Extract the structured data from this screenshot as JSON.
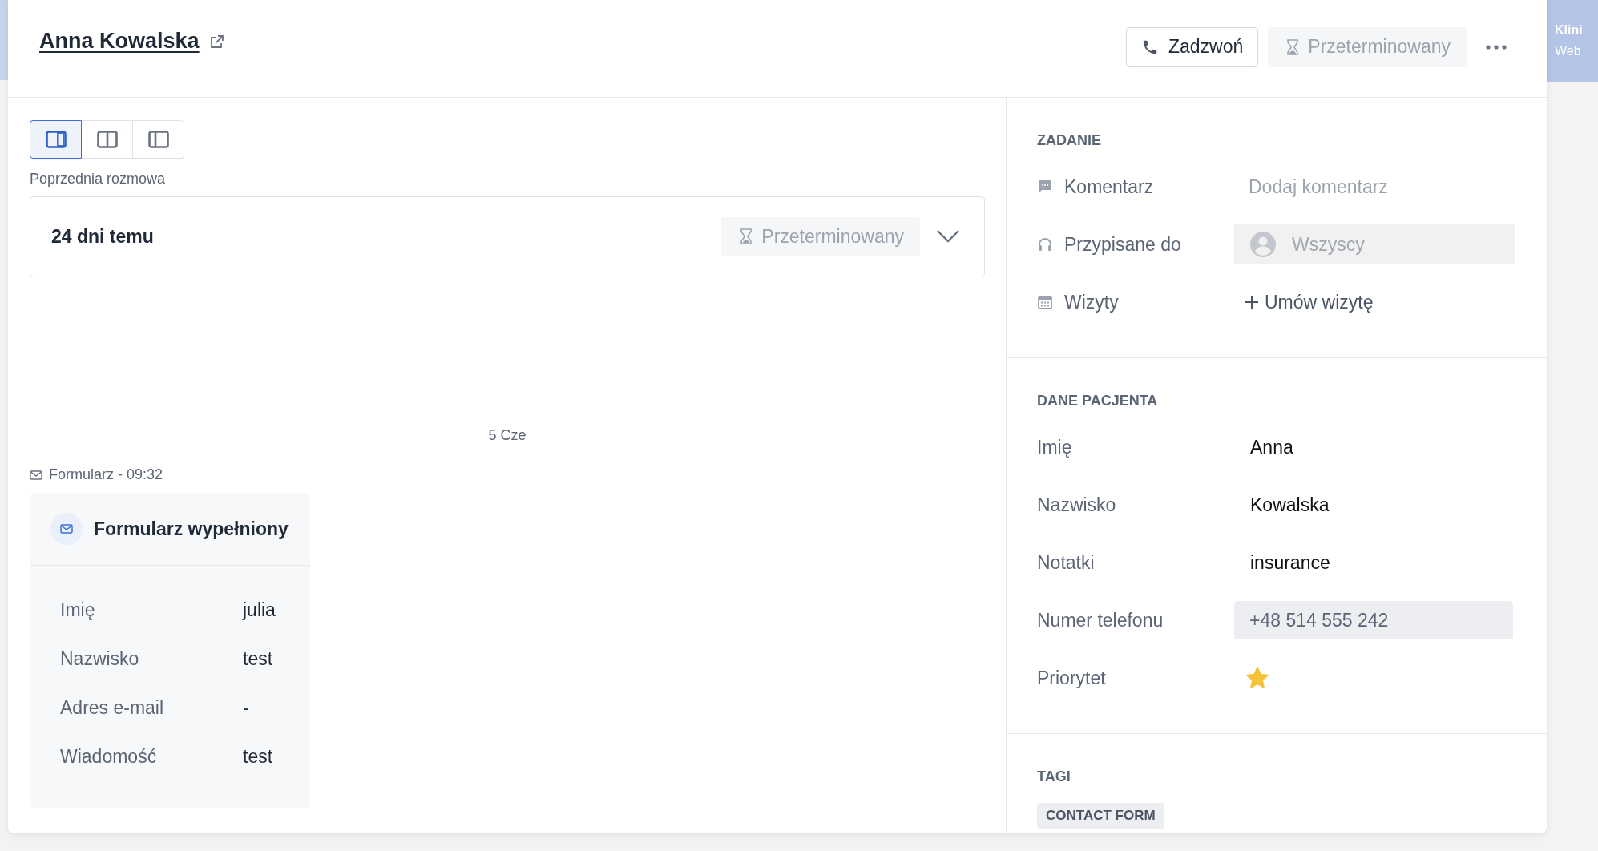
{
  "backdrop": {
    "right_title": "Klini",
    "right_subtitle": "Web"
  },
  "header": {
    "title": "Anna Kowalska",
    "call_button": "Zadzwoń",
    "status": "Przeterminowany"
  },
  "view_modes": [
    {
      "kind": "right",
      "selected": true
    },
    {
      "kind": "split",
      "selected": false
    },
    {
      "kind": "left",
      "selected": false
    }
  ],
  "previous_conversation": {
    "label": "Poprzednia rozmowa",
    "when": "24 dni temu",
    "status": "Przeterminowany",
    "expanded": false
  },
  "timeline": {
    "date": "5 Cze",
    "event_label": "Formularz - 09:32",
    "card": {
      "title": "Formularz wypełniony",
      "fields": [
        {
          "label": "Imię",
          "value": "julia"
        },
        {
          "label": "Nazwisko",
          "value": "test"
        },
        {
          "label": "Adres e-mail",
          "value": "-"
        },
        {
          "label": "Wiadomość",
          "value": "test"
        }
      ]
    }
  },
  "task": {
    "heading": "ZADANIE",
    "rows": [
      {
        "kind": "comment",
        "label": "Komentarz",
        "placeholder": "Dodaj komentarz"
      },
      {
        "kind": "assignee",
        "label": "Przypisane do",
        "placeholder": "Wszyscy"
      },
      {
        "kind": "visits",
        "label": "Wizyty",
        "action": "Umów wizytę"
      }
    ]
  },
  "patient": {
    "heading": "DANE PACJENTA",
    "fields": [
      {
        "kind": "text",
        "label": "Imię",
        "value": "Anna"
      },
      {
        "kind": "text",
        "label": "Nazwisko",
        "value": "Kowalska"
      },
      {
        "kind": "text",
        "label": "Notatki",
        "value": "insurance"
      },
      {
        "kind": "phone",
        "label": "Numer telefonu",
        "value": "+48 514 555 242"
      },
      {
        "kind": "priority",
        "label": "Priorytet",
        "on": true
      }
    ]
  },
  "tags": {
    "heading": "TAGI",
    "items": [
      "CONTACT FORM"
    ]
  }
}
